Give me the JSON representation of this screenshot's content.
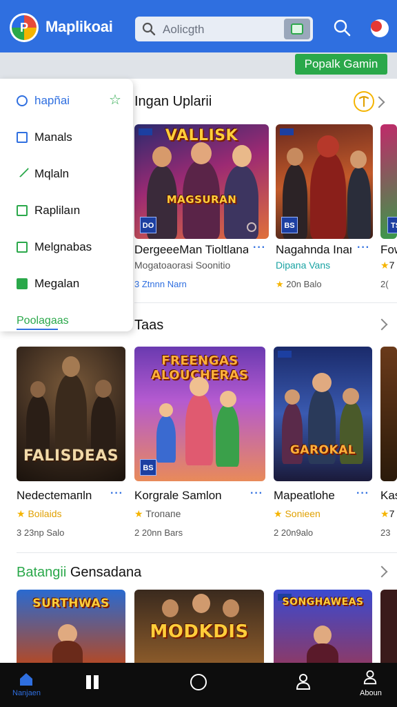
{
  "app": {
    "title": "Maplikoai",
    "logo_letter": "P"
  },
  "header": {
    "search_placeholder": "Aolicgth",
    "popular_button": "Popalk Gamin"
  },
  "drawer": {
    "items": [
      {
        "label": "hapñai",
        "icon": "compass-icon",
        "active": true
      },
      {
        "label": "Manals",
        "icon": "bookmark-icon"
      },
      {
        "label": "Mqlaln",
        "icon": "pencil-icon"
      },
      {
        "label": "Raplilaın",
        "icon": "list-icon"
      },
      {
        "label": "Melgnabas",
        "icon": "calendar-icon"
      },
      {
        "label": "Megalan",
        "icon": "gamepad-icon"
      }
    ],
    "footer": "Poolagaas"
  },
  "sections": [
    {
      "title": "Ingan Uplarii",
      "cards": [
        {
          "art": "VALLISK",
          "art2": "MAGSURAN",
          "badge": "DO",
          "name": "DergeeeMan Tioltlana",
          "sub": "Mogatoaorasi Soonitio",
          "meta": "3 Ztnnn Narn"
        },
        {
          "art": "",
          "art2": "",
          "badge": "BS",
          "name": "Nagahnda Inan",
          "sub": "Dipana Vans",
          "meta": "20n Balo"
        },
        {
          "art": "",
          "art2": "",
          "badge": "TS",
          "name": "Fow",
          "sub": "7",
          "meta": "2("
        }
      ]
    },
    {
      "title": "Taas",
      "cards": [
        {
          "art": "FALISDEAS",
          "art2": "",
          "badge": "",
          "name": "Nedectemaпln",
          "sub": "Boilaids",
          "meta": "3 23np Salo"
        },
        {
          "art": "FREENGAS ALOUCHERAS",
          "art2": "",
          "badge": "BS",
          "name": "Korgrale Samlon",
          "sub": "Troпaпe",
          "meta": "2 20nn Bars"
        },
        {
          "art": "GAROKAL",
          "art2": "",
          "badge": "",
          "name": "Mapeatlohe",
          "sub": "Sonieen",
          "meta": "2 20n9alo"
        },
        {
          "art": "",
          "art2": "",
          "badge": "",
          "name": "Kas",
          "sub": "7",
          "meta": "23"
        }
      ]
    },
    {
      "title": "Batangii Gensadana",
      "title_green": "Batangii",
      "title_rest": "Gensadana",
      "cards": [
        {
          "art": "SURTHWAS",
          "badge": ""
        },
        {
          "art": "MODKDIS",
          "badge": ""
        },
        {
          "art": "SONGHAWEAS",
          "badge": ""
        }
      ]
    }
  ],
  "bottom_nav": [
    {
      "label": "Nanjaen",
      "icon": "home-icon",
      "active": true
    },
    {
      "label": "",
      "icon": "library-icon"
    },
    {
      "label": "",
      "icon": "circle-icon"
    },
    {
      "label": "",
      "icon": "user-icon"
    },
    {
      "label": "Aboun",
      "icon": "profile-icon"
    }
  ],
  "colors": {
    "brand": "#2f6fe0",
    "accent": "#2aa84a",
    "nav_bg": "#0d0d0d"
  }
}
